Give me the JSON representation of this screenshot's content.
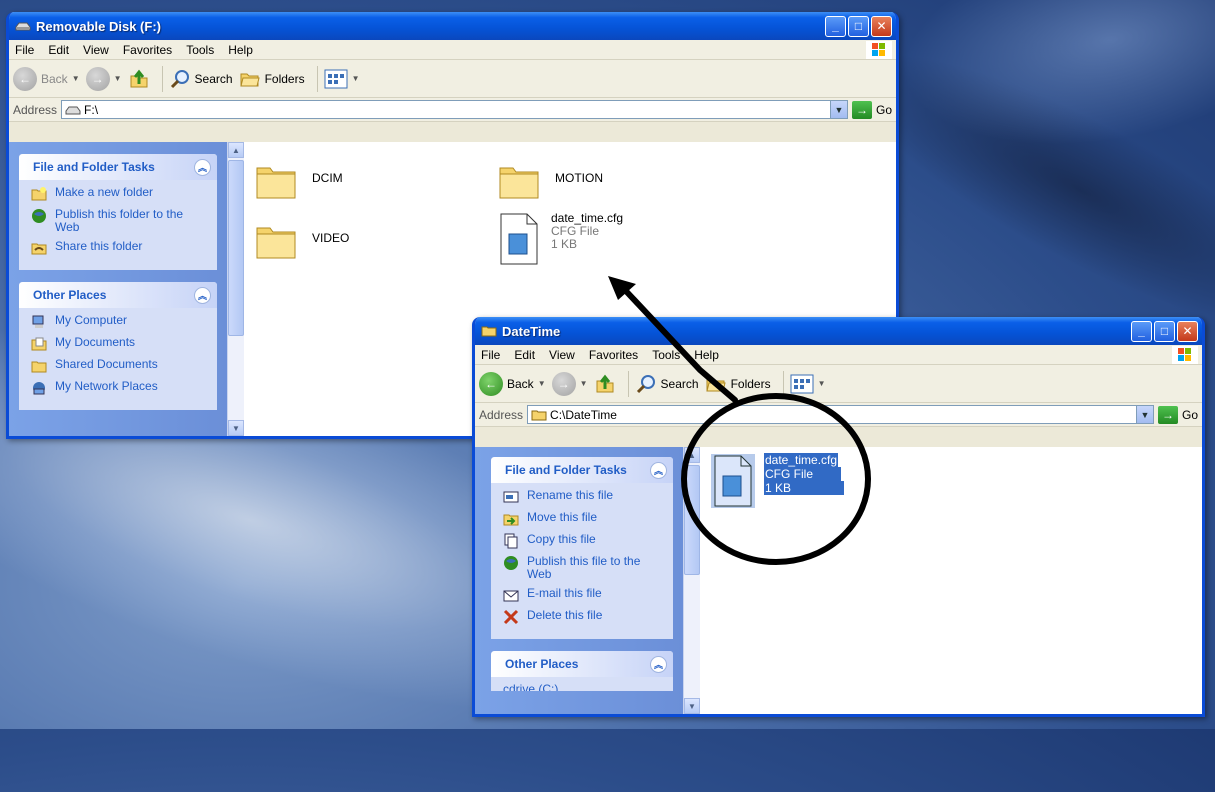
{
  "windows": {
    "back": {
      "title": "Removable Disk (F:)",
      "menu": [
        "File",
        "Edit",
        "View",
        "Favorites",
        "Tools",
        "Help"
      ],
      "toolbar": {
        "back": "Back",
        "search": "Search",
        "folders": "Folders"
      },
      "address_label": "Address",
      "address_value": "F:\\",
      "go": "Go",
      "task_panel_title": "File and Folder Tasks",
      "tasks": [
        "Make a new folder",
        "Publish this folder to the Web",
        "Share this folder"
      ],
      "places_title": "Other Places",
      "places": [
        "My Computer",
        "My Documents",
        "Shared Documents",
        "My Network Places"
      ],
      "files": [
        {
          "name": "DCIM",
          "type": "folder"
        },
        {
          "name": "MOTION",
          "type": "folder"
        },
        {
          "name": "VIDEO",
          "type": "folder"
        },
        {
          "name": "date_time.cfg",
          "type": "file",
          "kind": "CFG File",
          "size": "1 KB"
        }
      ]
    },
    "front": {
      "title": "DateTime",
      "menu": [
        "File",
        "Edit",
        "View",
        "Favorites",
        "Tools",
        "Help"
      ],
      "toolbar": {
        "back": "Back",
        "search": "Search",
        "folders": "Folders"
      },
      "address_label": "Address",
      "address_value": "C:\\DateTime",
      "go": "Go",
      "task_panel_title": "File and Folder Tasks",
      "tasks": [
        "Rename this file",
        "Move this file",
        "Copy this file",
        "Publish this file to the Web",
        "E-mail this file",
        "Delete this file"
      ],
      "places_title": "Other Places",
      "places_partial": "cdrive (C:)",
      "file": {
        "name": "date_time.cfg",
        "kind": "CFG File",
        "size": "1 KB"
      }
    }
  },
  "colors": {
    "titlebar": "#0553d6",
    "taskpane": "#6b8fd8",
    "link": "#215dc6",
    "selection": "#316ac5"
  }
}
